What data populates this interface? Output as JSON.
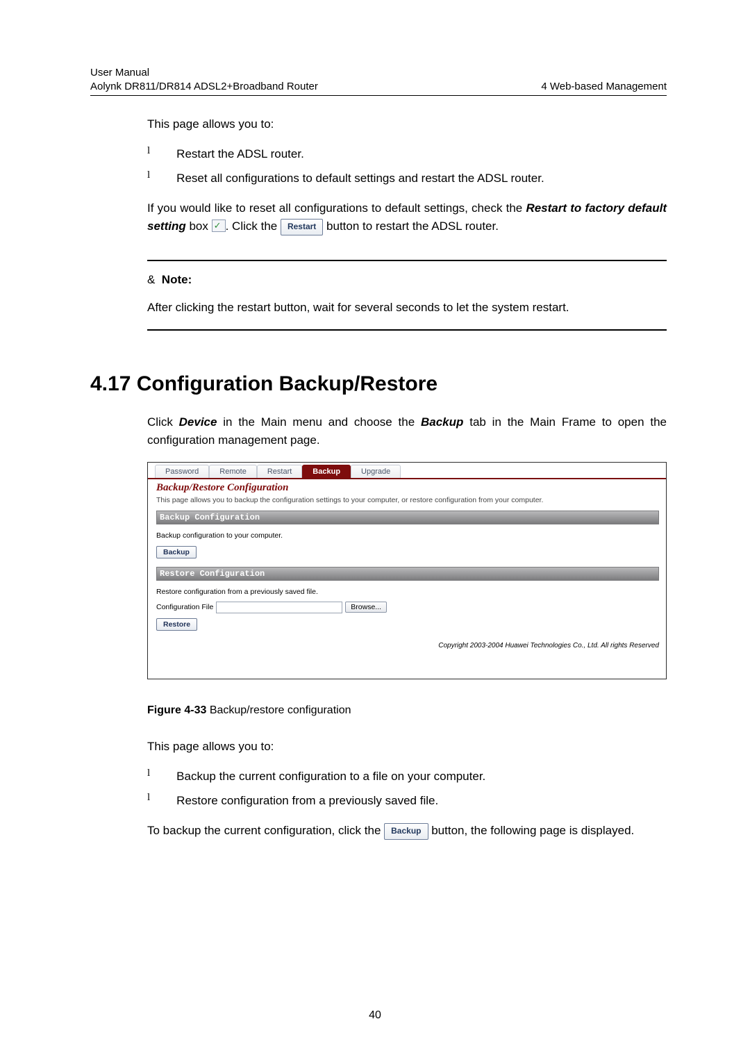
{
  "header": {
    "left_line1": "User Manual",
    "left_line2": "Aolynk DR811/DR814 ADSL2+Broadband Router",
    "right": "4  Web-based Management"
  },
  "intro": "This page allows you to:",
  "bullets_a": [
    "Restart the ADSL router.",
    "Reset all configurations to default settings and restart the ADSL router."
  ],
  "para_a1": "If you would like to reset all configurations to default settings, check the ",
  "para_a1_bold": "Restart to factory default setting",
  "para_a2": " box ",
  "para_a3": ". Click the ",
  "restart_btn": "Restart",
  "para_a4": " button to restart the ADSL router.",
  "note_symbol": "&",
  "note_label": "Note:",
  "note_body": "After clicking the restart button, wait for several seconds to let the system restart.",
  "h2": "4.17  Configuration Backup/Restore",
  "para_b1": "Click ",
  "para_b1_bold1": "Device",
  "para_b2": " in the Main menu and choose the ",
  "para_b1_bold2": "Backup",
  "para_b3": " tab in the Main Frame to open the configuration management page.",
  "shot": {
    "tabs": [
      "Password",
      "Remote",
      "Restart",
      "Backup",
      "Upgrade"
    ],
    "active_tab_index": 3,
    "title": "Backup/Restore Configuration",
    "subtitle": "This page allows you to backup the configuration settings to your computer, or restore configuration from your computer.",
    "sec1_title": "Backup Configuration",
    "sec1_text": "Backup configuration to your computer.",
    "sec1_btn": "Backup",
    "sec2_title": "Restore Configuration",
    "sec2_text": "Restore configuration from a previously saved file.",
    "file_label": "Configuration File",
    "browse": "Browse...",
    "sec2_btn": "Restore",
    "copyright": "Copyright 2003-2004 Huawei Technologies Co., Ltd. All rights Reserved"
  },
  "figcap_bold": "Figure 4-33 ",
  "figcap_rest": "Backup/restore configuration",
  "para_c_intro": "This page allows you to:",
  "bullets_c": [
    "Backup the current configuration to a file on your computer.",
    "Restore configuration from a previously saved file."
  ],
  "para_d1": "To backup the current configuration, click the ",
  "backup_btn": "Backup",
  "para_d2": " button, the following page is displayed.",
  "page_num": "40"
}
